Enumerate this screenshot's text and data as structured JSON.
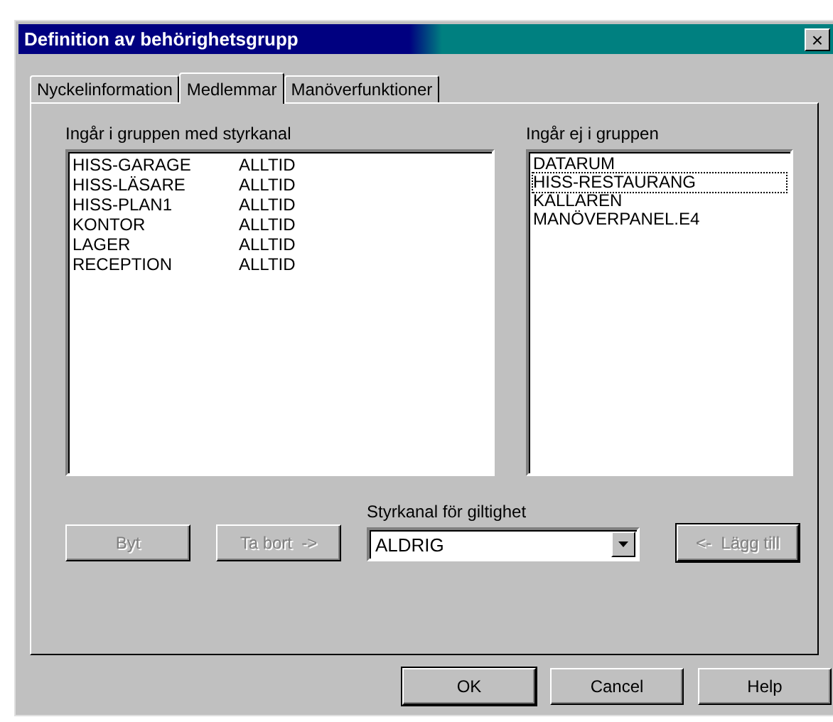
{
  "window": {
    "title": "Definition av behörighetsgrupp",
    "close": "×"
  },
  "tabs": [
    {
      "label": "Nyckelinformation",
      "selected": false
    },
    {
      "label": "Medlemmar",
      "selected": true
    },
    {
      "label": "Manöverfunktioner",
      "selected": false
    }
  ],
  "members": {
    "label": "Ingår i gruppen med styrkanal",
    "rows": [
      {
        "name": "HISS-GARAGE",
        "channel": "ALLTID"
      },
      {
        "name": "HISS-LÄSARE",
        "channel": "ALLTID"
      },
      {
        "name": "HISS-PLAN1",
        "channel": "ALLTID"
      },
      {
        "name": "KONTOR",
        "channel": "ALLTID"
      },
      {
        "name": "LAGER",
        "channel": "ALLTID"
      },
      {
        "name": "RECEPTION",
        "channel": "ALLTID"
      }
    ]
  },
  "non_members": {
    "label": "Ingår ej i gruppen",
    "items": [
      {
        "name": "DATARUM",
        "focused": false
      },
      {
        "name": "HISS-RESTAURANG",
        "focused": true
      },
      {
        "name": "KÄLLAREN",
        "focused": false
      },
      {
        "name": "MANÖVERPANEL.E4",
        "focused": false
      }
    ]
  },
  "actions": [
    {
      "label": "Byt",
      "disabled": true
    },
    {
      "label": "Ta bort  ->",
      "disabled": true
    }
  ],
  "channel_select": {
    "label": "Styrkanal för giltighet",
    "value": "ALDRIG"
  },
  "add_button": {
    "label": "<-  Lägg till",
    "disabled": true
  },
  "buttons": [
    {
      "label": "OK"
    },
    {
      "label": "Cancel"
    },
    {
      "label": "Help"
    }
  ]
}
